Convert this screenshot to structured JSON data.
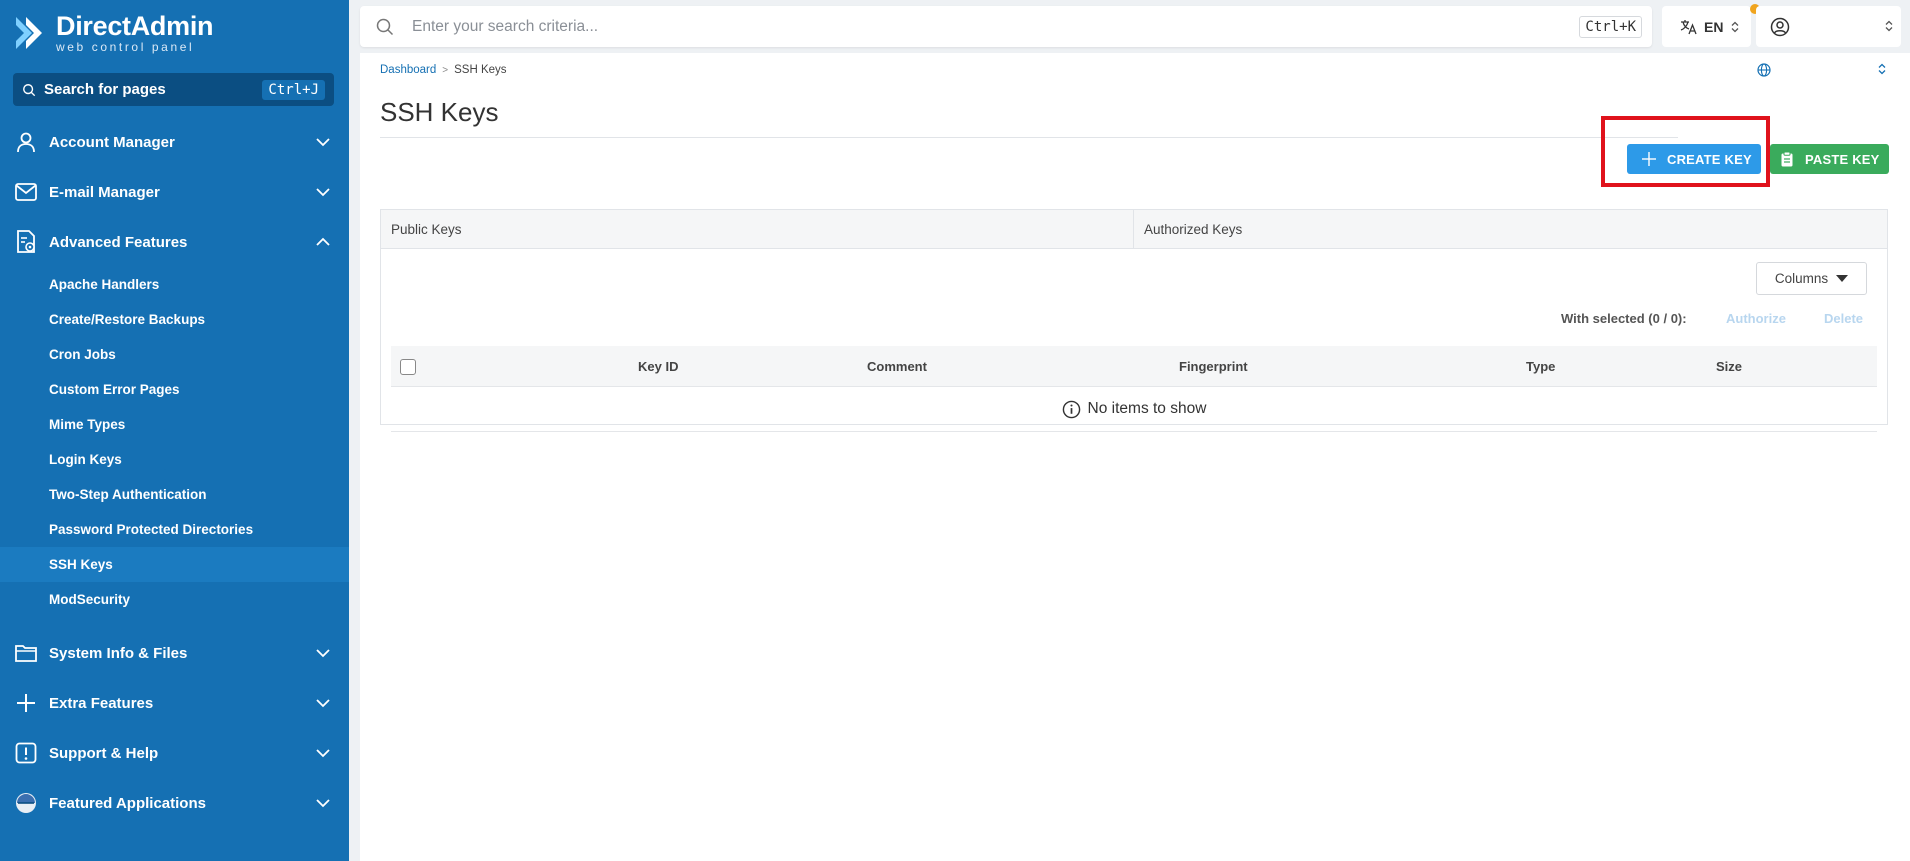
{
  "app": {
    "brand_name": "DirectAdmin",
    "brand_tagline": "web control panel"
  },
  "sidebar": {
    "search_label": "Search for pages",
    "search_shortcut": "Ctrl+J",
    "sections": [
      {
        "label": "Account Manager",
        "icon": "user-icon",
        "expanded": false
      },
      {
        "label": "E-mail Manager",
        "icon": "mail-icon",
        "expanded": false
      },
      {
        "label": "Advanced Features",
        "icon": "advanced-features-icon",
        "expanded": true
      },
      {
        "label": "System Info & Files",
        "icon": "folder-icon",
        "expanded": false
      },
      {
        "label": "Extra Features",
        "icon": "plus-icon",
        "expanded": false
      },
      {
        "label": "Support & Help",
        "icon": "support-icon",
        "expanded": false
      },
      {
        "label": "Featured Applications",
        "icon": "featured-apps-icon",
        "expanded": false
      }
    ],
    "advanced_items": [
      {
        "label": "Apache Handlers"
      },
      {
        "label": "Create/Restore Backups"
      },
      {
        "label": "Cron Jobs"
      },
      {
        "label": "Custom Error Pages"
      },
      {
        "label": "Mime Types"
      },
      {
        "label": "Login Keys"
      },
      {
        "label": "Two-Step Authentication"
      },
      {
        "label": "Password Protected Directories"
      },
      {
        "label": "SSH Keys",
        "active": true
      },
      {
        "label": "ModSecurity"
      }
    ]
  },
  "topbar": {
    "search_placeholder": "Enter your search criteria...",
    "search_shortcut": "Ctrl+K",
    "language": "EN"
  },
  "breadcrumb": {
    "home": "Dashboard",
    "current": "SSH Keys"
  },
  "page": {
    "title": "SSH Keys",
    "create_key_label": "CREATE KEY",
    "paste_key_label": "PASTE KEY"
  },
  "tabs": [
    {
      "label": "Public Keys",
      "active": true
    },
    {
      "label": "Authorized Keys",
      "active": false
    }
  ],
  "table": {
    "columns_button": "Columns",
    "with_selected": "With selected (0 / 0):",
    "authorize_label": "Authorize",
    "delete_label": "Delete",
    "headers": [
      "Key ID",
      "Comment",
      "Fingerprint",
      "Type",
      "Size"
    ],
    "empty_message": "No items to show"
  },
  "colors": {
    "sidebar_bg": "#1570b3",
    "create_button": "#2d9ae8",
    "paste_button": "#3aab5c",
    "highlight": "#e0121c"
  }
}
